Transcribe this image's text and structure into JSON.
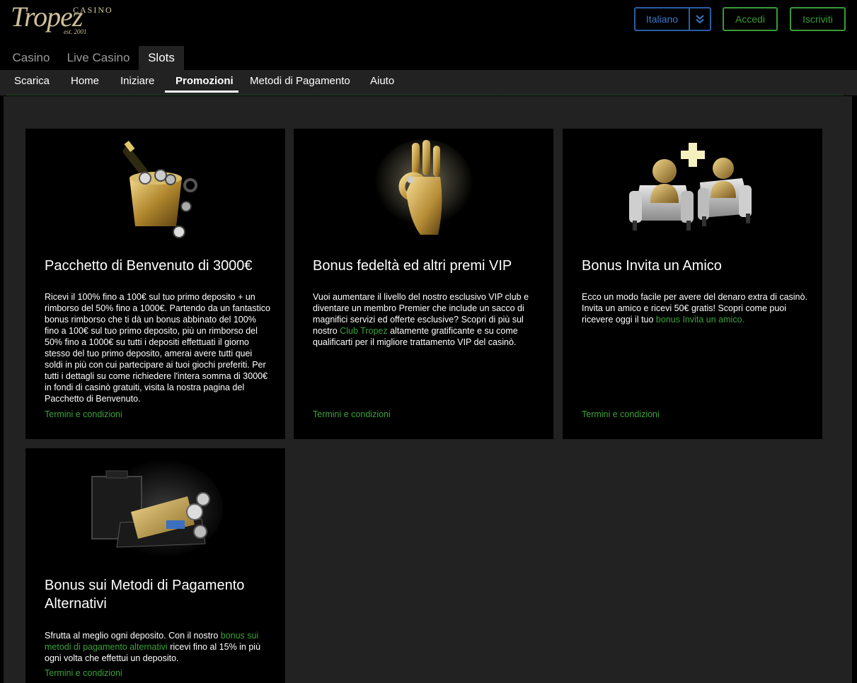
{
  "header": {
    "logo": {
      "casino": "CASINO",
      "brand": "Tropez",
      "est": "est. 2001"
    },
    "language": "Italiano",
    "login_label": "Accedi",
    "register_label": "Iscriviti"
  },
  "tabs": [
    "Casino",
    "Live Casino",
    "Slots"
  ],
  "active_tab": "Slots",
  "subnav": [
    "Scarica",
    "Home",
    "Iniziare",
    "Promozioni",
    "Metodi di Pagamento",
    "Aiuto"
  ],
  "active_subnav": "Promozioni",
  "cards": [
    {
      "image": "champagne-bucket-chips",
      "title": "Pacchetto di Benvenuto di 3000€",
      "text": "Ricevi il 100% fino a 100€ sul tuo primo deposito + un rimborso del 50% fino a 1000€. Partendo da un fantastico bonus rimborso che ti dà un bonus abbinato del 100% fino a 100€ sul tuo primo deposito, più un rimborso del 50% fino a 1000€ su tutti i depositi effettuati il giorno stesso del tuo primo deposito, amerai avere tutti quei soldi in più con cui partecipare ai tuoi giochi preferiti. Per tutti i dettagli su come richiedere l'intera somma di 3000€ in fondi di casinò gratuiti, visita la nostra pagina del Pacchetto di Benvenuto.",
      "terms": "Termini e condizioni"
    },
    {
      "image": "golden-hand-ok",
      "title": "Bonus fedeltà ed altri premi VIP",
      "text_before": "Vuoi aumentare il livello del nostro esclusivo VIP club e diventare un membro Premier che include un sacco di magnifici servizi ed offerte esclusive? Scopri di più sul nostro ",
      "link": "Club Tropez",
      "text_after": " altamente gratificante e su come qualificarti per il migliore trattamento VIP del casinò.",
      "terms": "Termini e condizioni"
    },
    {
      "image": "two-figures-armchairs-plus",
      "title": "Bonus Invita un Amico",
      "text_before": "Ecco un modo facile per avere del denaro extra di casinò. Invita un amico e ricevi 50€ gratis! Scopri come puoi ricevere oggi il tuo ",
      "link": "bonus Invita un amico.",
      "text_after": "",
      "terms": "Termini e condizioni"
    },
    {
      "image": "briefcase-card-chips",
      "title": "Bonus sui Metodi di Pagamento Alternativi",
      "text_before": "Sfrutta al meglio ogni deposito. Con il nostro ",
      "link": "bonus sui metodi di pagamento alternativi",
      "text_after": " ricevi fino al 15% in più ogni volta che effettui un deposito.",
      "terms": "Termini e condizioni"
    }
  ]
}
